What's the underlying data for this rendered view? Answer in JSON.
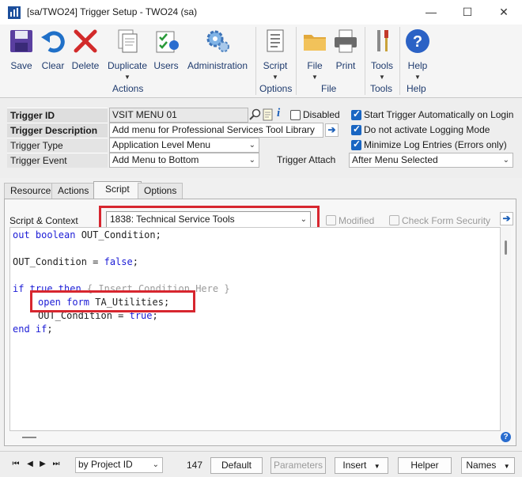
{
  "window": {
    "title": "[sa/TWO24] Trigger Setup  -  TWO24 (sa)",
    "min_icon": "minimize-icon",
    "max_icon": "maximize-icon",
    "close_icon": "close-icon"
  },
  "ribbon": {
    "buttons": [
      {
        "label": "Save",
        "icon": "save-icon"
      },
      {
        "label": "Clear",
        "icon": "undo-icon"
      },
      {
        "label": "Delete",
        "icon": "delete-x-icon"
      },
      {
        "label": "Duplicate",
        "icon": "duplicate-icon"
      },
      {
        "label": "Users",
        "icon": "users-icon"
      },
      {
        "label": "Administration",
        "icon": "gears-icon"
      },
      {
        "label": "Script",
        "icon": "script-icon"
      },
      {
        "label": "File",
        "icon": "folder-icon"
      },
      {
        "label": "Print",
        "icon": "printer-icon"
      },
      {
        "label": "Tools",
        "icon": "tools-icon"
      },
      {
        "label": "Help",
        "icon": "help-icon"
      }
    ],
    "groups": {
      "actions": "Actions",
      "options": "Options",
      "file": "File",
      "tools": "Tools",
      "help": "Help"
    }
  },
  "form": {
    "trigger_id_label": "Trigger ID",
    "trigger_id_value": "VSIT MENU 01",
    "disabled_label": "Disabled",
    "trigger_description_label": "Trigger Description",
    "trigger_description_value": "Add menu for Professional Services Tool Library",
    "trigger_type_label": "Trigger Type",
    "trigger_type_value": "Application Level Menu",
    "trigger_event_label": "Trigger Event",
    "trigger_event_value": "Add Menu to Bottom",
    "trigger_attach_label": "Trigger Attach",
    "trigger_attach_value": "After Menu Selected",
    "start_auto_label": "Start Trigger Automatically on Login",
    "no_logging_label": "Do not activate Logging Mode",
    "minimize_log_label": "Minimize Log Entries (Errors only)"
  },
  "tabs": [
    "Resource",
    "Actions",
    "Script",
    "Options"
  ],
  "script": {
    "context_label": "Script & Context",
    "context_value": "1838: Technical Service Tools",
    "modified_label": "Modified",
    "check_security_label": "Check Form Security",
    "lines": {
      "l1_kw": "out boolean",
      "l1_rest": " OUT_Condition;",
      "l2_a": "OUT_Condition = ",
      "l2_kw": "false",
      "l2_b": ";",
      "l3_kw1": "if true then",
      "l3_cmt": " { Insert Condition Here }",
      "l4_kw": "open form",
      "l4_rest": " TA_Utilities;",
      "l5_a": "OUT_Condition = ",
      "l5_kw": "true",
      "l5_b": ";",
      "l6_kw": "end if",
      "l6_b": ";"
    }
  },
  "bottom": {
    "sort_value": "by Project ID",
    "record_count": "147",
    "default_label": "Default",
    "parameters_label": "Parameters",
    "insert_label": "Insert",
    "helper_label": "Helper",
    "names_label": "Names"
  }
}
